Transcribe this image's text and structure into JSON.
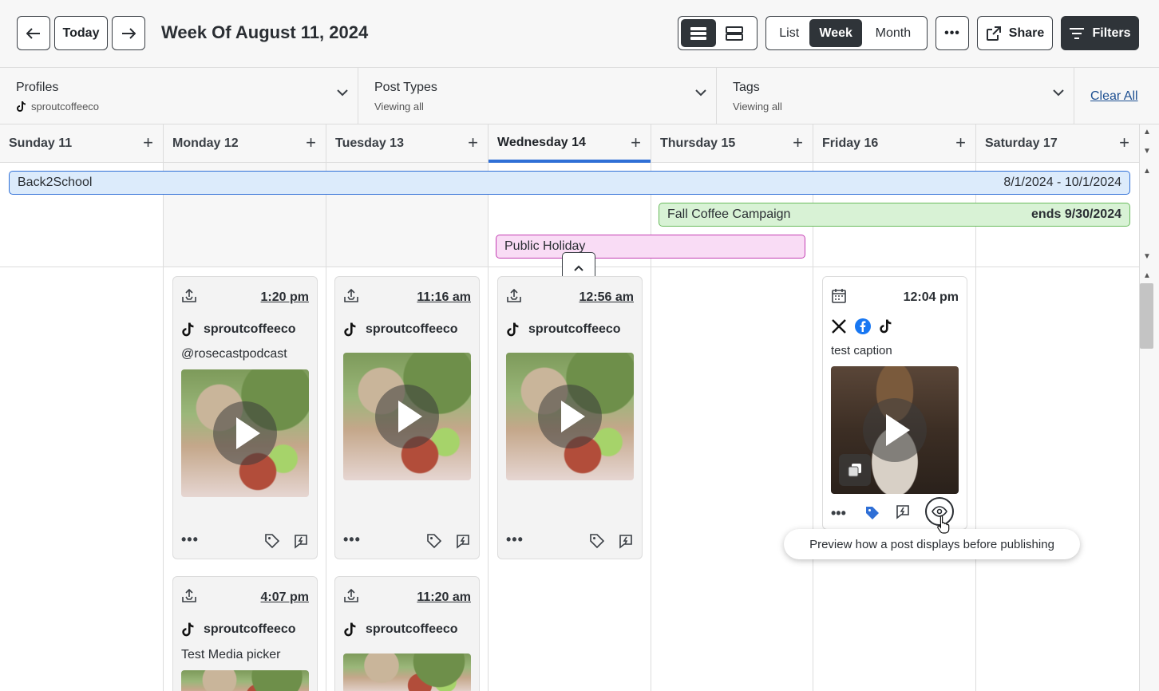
{
  "toolbar": {
    "prev_icon": "arrow-left-icon",
    "today_label": "Today",
    "next_icon": "arrow-right-icon",
    "week_title": "Week Of August 11, 2024",
    "view_modes": [
      "List",
      "Week",
      "Month"
    ],
    "active_view": "Week",
    "more_label": "•••",
    "share_label": "Share",
    "filters_label": "Filters"
  },
  "filters": {
    "profiles_label": "Profiles",
    "profiles_value": "sproutcoffeeco",
    "post_types_label": "Post Types",
    "post_types_value": "Viewing all",
    "tags_label": "Tags",
    "tags_value": "Viewing all",
    "clear_all_label": "Clear All"
  },
  "days": [
    {
      "name": "Sunday 11"
    },
    {
      "name": "Monday 12"
    },
    {
      "name": "Tuesday 13"
    },
    {
      "name": "Wednesday 14"
    },
    {
      "name": "Thursday 15"
    },
    {
      "name": "Friday 16"
    },
    {
      "name": "Saturday 17"
    }
  ],
  "campaigns": [
    {
      "name": "Back2School",
      "dates": "8/1/2024 - 10/1/2024"
    },
    {
      "name": "Fall Coffee Campaign",
      "dates": "ends 9/30/2024"
    },
    {
      "name": "Public Holiday",
      "dates": ""
    }
  ],
  "posts": {
    "mon1": {
      "time": "1:20 pm",
      "profile": "sproutcoffeeco",
      "caption": "@rosecastpodcast"
    },
    "tue1": {
      "time": "11:16 am",
      "profile": "sproutcoffeeco"
    },
    "wed1": {
      "time": "12:56 am",
      "profile": "sproutcoffeeco"
    },
    "fri1": {
      "time": "12:04 pm",
      "caption": "test caption"
    },
    "mon2": {
      "time": "4:07 pm",
      "profile": "sproutcoffeeco",
      "caption": "Test Media picker"
    },
    "tue2": {
      "time": "11:20 am",
      "profile": "sproutcoffeeco"
    }
  },
  "tooltip": "Preview how a post displays before publishing",
  "colors": {
    "accent": "#2f6fd6",
    "dark": "#2f3439",
    "campaign_blue": "#dcebfb",
    "campaign_green": "#d8f2d5",
    "campaign_pink": "#f9dcf5",
    "link": "#1d4f91"
  }
}
